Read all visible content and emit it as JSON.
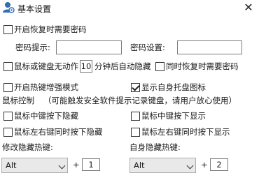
{
  "window": {
    "title": "基本设置",
    "close_glyph": "✕"
  },
  "password": {
    "enable_label": "开启恢复时需要密码",
    "enable_checked": false,
    "hint_label": "密码提示:",
    "hint_value": "",
    "set_label": "密码设置:",
    "set_value": ""
  },
  "auto_hide": {
    "prefix_label": "鼠标或键盘无动作",
    "minutes_value": "10",
    "suffix_label": "分钟后自动隐藏",
    "checked": false,
    "restore_password_label": "同时恢复时需要密码",
    "restore_password_checked": false
  },
  "options": {
    "hotkey_enhance_label": "开启热键增强模式",
    "hotkey_enhance_checked": false,
    "show_tray_label": "显示自身托盘图标",
    "show_tray_checked": true
  },
  "mouse_control": {
    "heading": "鼠标控制",
    "note": "（可能触发安全软件提示记录键盘，请用户放心使用）",
    "middle_hide_label": "鼠标中键按下隐藏",
    "middle_hide_checked": false,
    "middle_show_label": "鼠标中键按下显示",
    "middle_show_checked": false,
    "lr_hide_label": "鼠标左右键同时按下隐藏",
    "lr_hide_checked": false,
    "lr_show_label": "鼠标左右键同时按下显示",
    "lr_show_checked": false
  },
  "hotkeys": {
    "modify_label": "修改隐藏热键:",
    "modify_modifier": "Alt",
    "modify_plus": "+",
    "modify_key": "1",
    "self_label": "自身隐藏热键:",
    "self_modifier": "Alt",
    "self_plus": "+",
    "self_key": "2"
  },
  "colors": {
    "background": "#ffffff",
    "icon_blue": "#2f6db5"
  },
  "icons": {
    "app": "user-settings-icon",
    "close": "close-icon"
  }
}
